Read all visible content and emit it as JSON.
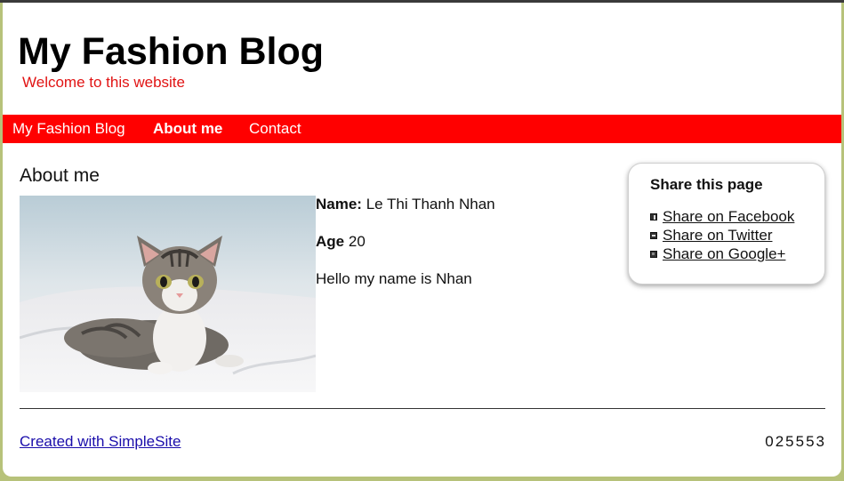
{
  "header": {
    "title": "My Fashion Blog",
    "subtitle": "Welcome to this website"
  },
  "nav": {
    "items": [
      {
        "label": "My Fashion Blog",
        "active": false
      },
      {
        "label": "About me",
        "active": true
      },
      {
        "label": "Contact",
        "active": false
      }
    ]
  },
  "content": {
    "heading": "About me",
    "name_label": "Name:",
    "name_value": "Le Thi Thanh Nhan",
    "age_label": "Age",
    "age_value": "20",
    "bio": "Hello my name is Nhan",
    "photo_icon": "cat-photo"
  },
  "share": {
    "title": "Share this page",
    "items": [
      {
        "label": "Share on Facebook",
        "icon": "facebook-icon"
      },
      {
        "label": "Share on Twitter",
        "icon": "twitter-icon"
      },
      {
        "label": "Share on Google+",
        "icon": "google-plus-icon"
      }
    ]
  },
  "footer": {
    "credit": "Created with SimpleSite",
    "counter": "025553"
  },
  "colors": {
    "nav_background": "#ff0000",
    "subtitle": "#e11313",
    "link": "#1a0dab",
    "outer_background": "#b7c27a"
  }
}
